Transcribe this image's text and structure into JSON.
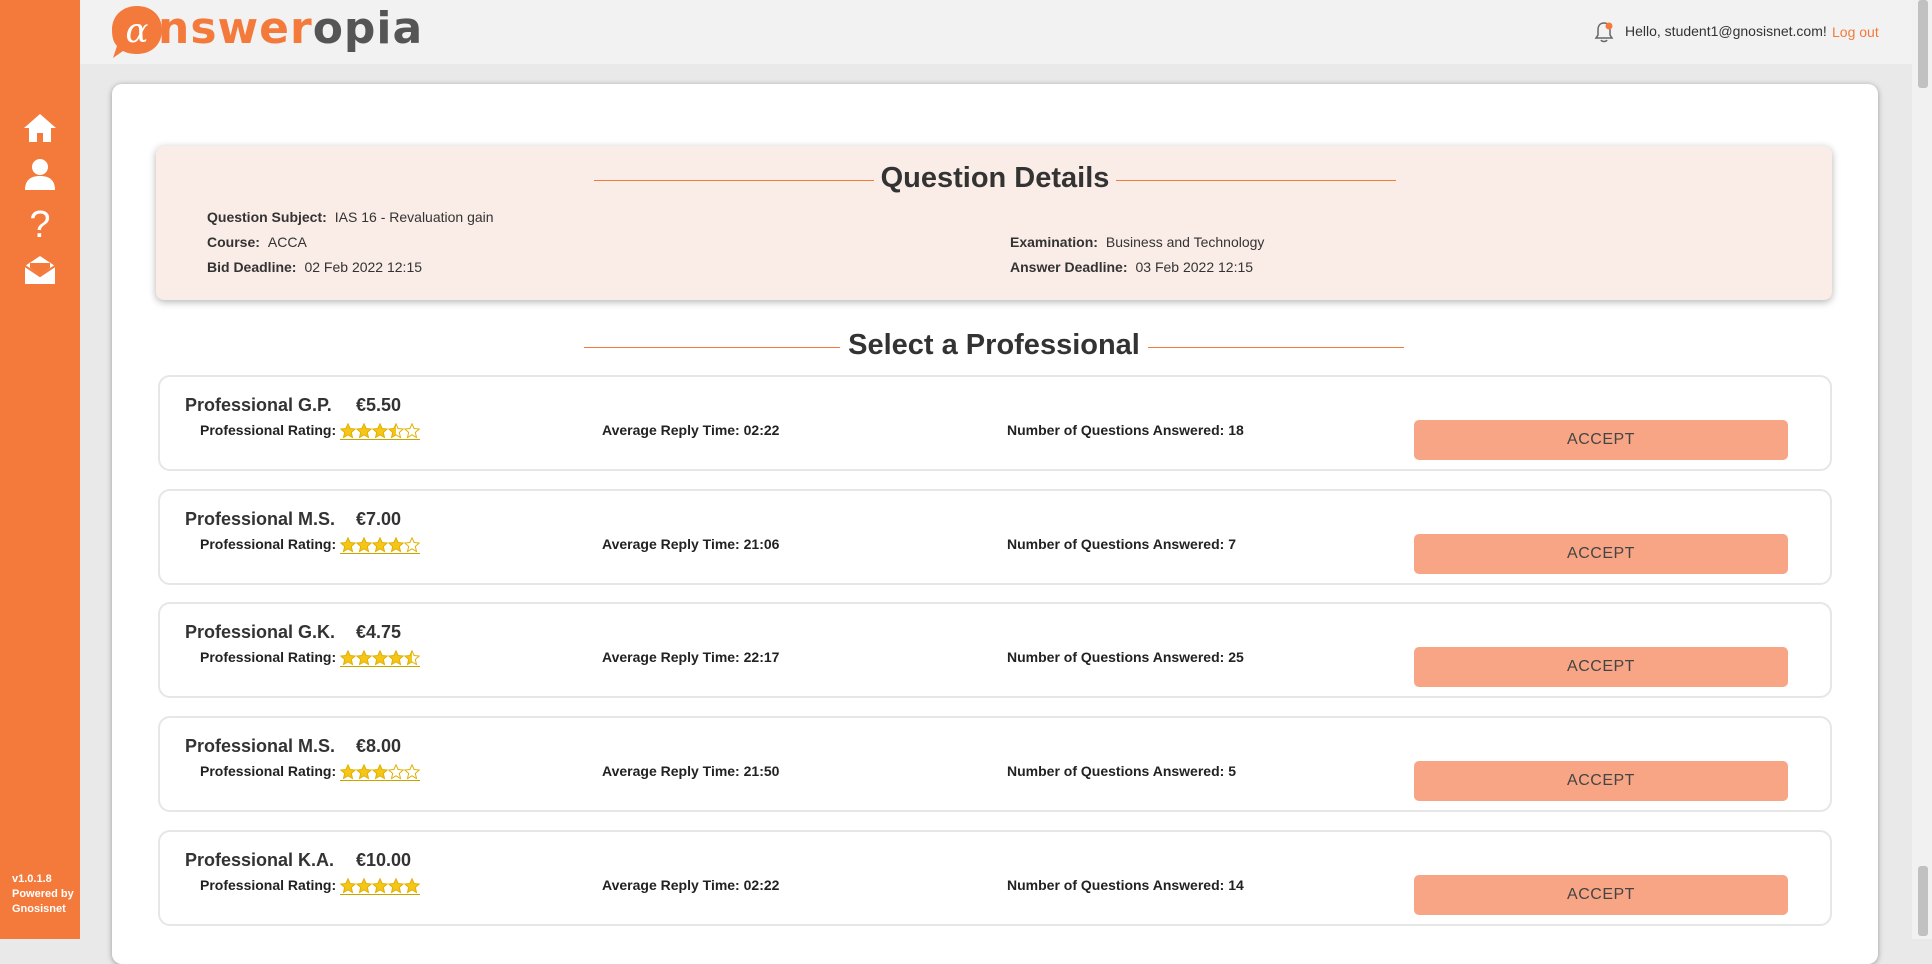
{
  "app": {
    "logo_text": "answeropia",
    "version": "v1.0.1.8",
    "powered_by": "Powered by",
    "powered_by_name": "Gnosisnet"
  },
  "header": {
    "greeting": "Hello, student1@gnosisnet.com!",
    "logout_label": "Log out"
  },
  "sidebar": {
    "icons": [
      "home-icon",
      "user-icon",
      "help-icon",
      "messages-icon"
    ]
  },
  "question": {
    "title": "Question Details",
    "subject_label": "Question Subject:",
    "subject_value": "IAS 16 - Revaluation gain",
    "course_label": "Course:",
    "course_value": "ACCA",
    "examination_label": "Examination:",
    "examination_value": "Business and Technology",
    "bid_deadline_label": "Bid Deadline:",
    "bid_deadline_value": "02 Feb 2022 12:15",
    "answer_deadline_label": "Answer Deadline:",
    "answer_deadline_value": "03 Feb 2022 12:15"
  },
  "select_title": "Select a Professional",
  "labels": {
    "rating": "Professional Rating:",
    "reply": "Average Reply Time:",
    "answered": "Number of Questions Answered:",
    "accept": "ACCEPT"
  },
  "professionals": [
    {
      "name": "Professional G.P.",
      "price": "€5.50",
      "rating": 3.5,
      "reply_time": "02:22",
      "answered": "18"
    },
    {
      "name": "Professional M.S.",
      "price": "€7.00",
      "rating": 4,
      "reply_time": "21:06",
      "answered": "7"
    },
    {
      "name": "Professional G.K.",
      "price": "€4.75",
      "rating": 4.5,
      "reply_time": "22:17",
      "answered": "25"
    },
    {
      "name": "Professional M.S.",
      "price": "€8.00",
      "rating": 3,
      "reply_time": "21:50",
      "answered": "5"
    },
    {
      "name": "Professional K.A.",
      "price": "€10.00",
      "rating": 5,
      "reply_time": "02:22",
      "answered": "14"
    }
  ],
  "colors": {
    "brand": "#f47a3c",
    "accept_button": "#f7a585",
    "details_bg": "#faece6",
    "star": "#f5c518"
  }
}
